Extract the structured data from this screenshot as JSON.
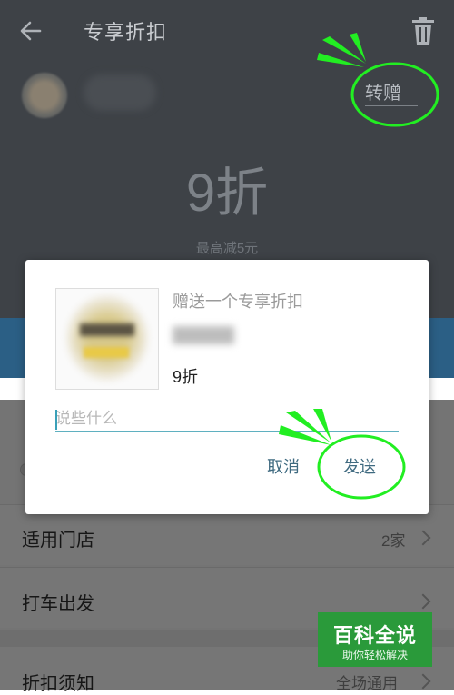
{
  "header": {
    "title": "专享折扣",
    "back_icon": "arrow-left-icon",
    "delete_icon": "trash-icon"
  },
  "hero": {
    "transfer_label": "转赠",
    "discount": "9折",
    "max_save": "最高减5元"
  },
  "list": {
    "rows": [
      {
        "label": "适用门店",
        "value": "2家"
      },
      {
        "label": "打车出发",
        "value": ""
      },
      {
        "label": "折扣须知",
        "value": "全场通用"
      }
    ]
  },
  "dialog": {
    "title": "赠送一个专享折扣",
    "discount": "9折",
    "message_placeholder": "说些什么",
    "cancel_label": "取消",
    "send_label": "发送"
  },
  "watermark": {
    "main": "百科全说",
    "sub": "助你轻松解决"
  },
  "colors": {
    "annotation_green": "#22ee22",
    "dialog_button": "#3f6a80",
    "watermark_bg": "#2a9a3a"
  }
}
